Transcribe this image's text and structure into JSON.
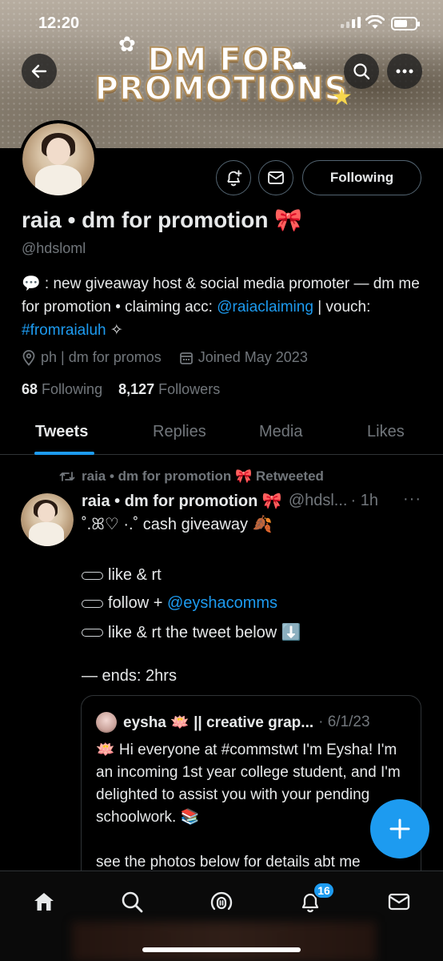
{
  "status_bar": {
    "time": "12:20"
  },
  "banner": {
    "line1": "DM FOR",
    "line2": "PROMOTIONS"
  },
  "profile": {
    "name": "raia • dm for promotion 🎀",
    "handle": "@hdsloml",
    "bio_prefix": "💬 : new giveaway host & social media promoter — dm me for promotion • claiming acc: ",
    "bio_link1": "@raiaclaiming",
    "bio_middle": " | vouch: ",
    "bio_link2": "#fromraialuh",
    "bio_suffix": " ✧",
    "location": "ph | dm for promos",
    "joined": "Joined May 2023",
    "following_count": "68",
    "following_label": "Following",
    "followers_count": "8,127",
    "followers_label": "Followers",
    "follow_button": "Following"
  },
  "tabs": [
    {
      "label": "Tweets",
      "active": true
    },
    {
      "label": "Replies",
      "active": false
    },
    {
      "label": "Media",
      "active": false
    },
    {
      "label": "Likes",
      "active": false
    }
  ],
  "tweet": {
    "retweet_by": "raia • dm for promotion 🎀 Retweeted",
    "author_name": "raia • dm for promotion 🎀",
    "author_handle": "@hdsl...",
    "time": "· 1h",
    "more": "···",
    "line1": "˚.ꕤ♡ ·.˚  cash giveaway 🍂",
    "item1": "like & rt",
    "item2_prefix": "follow + ",
    "item2_link": "@eyshacomms",
    "item3": "like & rt the tweet below ⬇️",
    "ends": "— ends: 2hrs",
    "quote": {
      "author_name": "eysha 🪷 || creative grap...",
      "date": "· 6/1/23",
      "body1": "🪷 Hi everyone at #commstwt I'm Eysha! I'm an incoming 1st year college student, and I'm delighted to assist you with your pending schoolwork. 📚",
      "body2": "see the photos below for details abt me"
    }
  },
  "nav": {
    "notifications_badge": "16"
  },
  "colors": {
    "accent": "#1d9bf0",
    "muted": "#71767b",
    "text": "#e7e9ea",
    "border": "#2f3336"
  }
}
